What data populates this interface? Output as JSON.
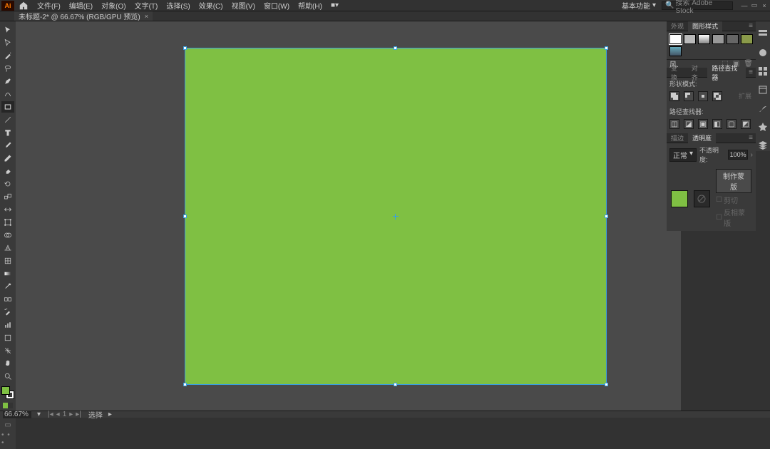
{
  "app": {
    "logo": "Ai"
  },
  "menu": {
    "file": "文件(F)",
    "edit": "编辑(E)",
    "object": "对象(O)",
    "type": "文字(T)",
    "select": "选择(S)",
    "effect": "效果(C)",
    "view": "视图(V)",
    "window": "窗口(W)",
    "help": "帮助(H)",
    "extra": "■▾"
  },
  "header": {
    "workspace": "基本功能",
    "search_placeholder": "搜索 Adobe Stock"
  },
  "doctab": {
    "title": "未标题-2* @ 66.67% (RGB/GPU 预览)",
    "close": "×"
  },
  "colors": {
    "fill": "#7fc043",
    "stroke": "#ffffff",
    "selection": "#3aa0e0"
  },
  "panels": {
    "styles": {
      "tab1": "外观",
      "tab2": "图形样式",
      "footer_label": "风."
    },
    "pathfinder": {
      "tab1": "变换",
      "tab2": "对齐",
      "tab3": "路径查找器",
      "shape_modes": "形状模式:",
      "pathfinders": "路径查找器:",
      "expand": "扩展"
    },
    "transparency": {
      "tab1": "描边",
      "tab2": "透明度",
      "blend": "正常",
      "opacity_label": "不透明度:",
      "opacity_value": "100%",
      "make_mask": "制作蒙版",
      "clip": "剪切",
      "invert": "反相蒙版"
    }
  },
  "statusbar": {
    "zoom": "66.67%",
    "selection": "选择",
    "doc": "▸"
  }
}
